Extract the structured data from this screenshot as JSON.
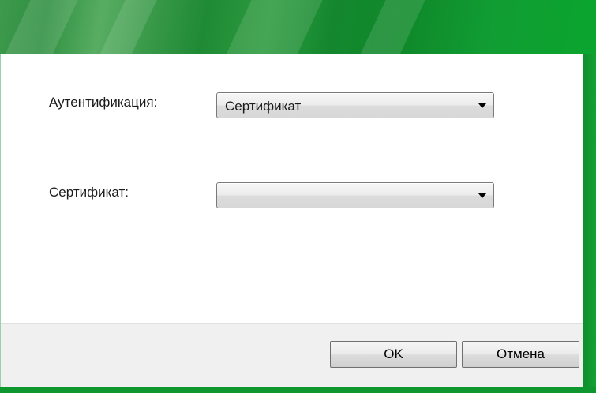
{
  "dialog": {
    "colors": {
      "frame_green": "#11a232",
      "footer_bg": "#f0f0f0"
    }
  },
  "form": {
    "authentication": {
      "label": "Аутентификация:",
      "value": "Сертификат"
    },
    "certificate": {
      "label": "Сертификат:",
      "value": ""
    }
  },
  "buttons": {
    "ok_label": "OK",
    "cancel_label": "Отмена"
  }
}
